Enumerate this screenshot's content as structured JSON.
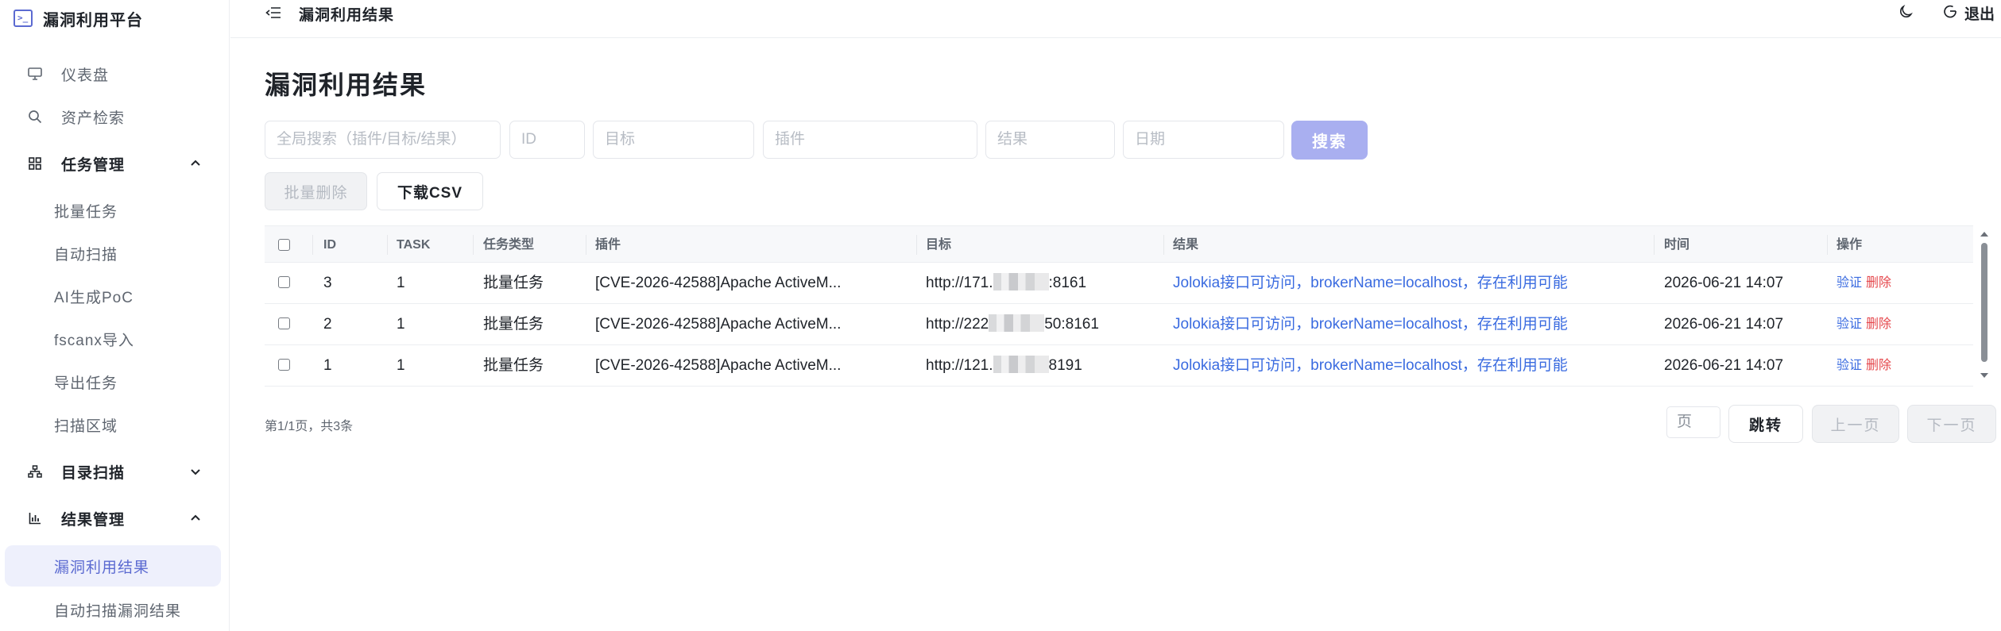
{
  "sidebar": {
    "brand_title": "漏洞利用平台",
    "items": [
      {
        "label": "仪表盘",
        "icon": "monitor-icon"
      },
      {
        "label": "资产检索",
        "icon": "search-icon"
      },
      {
        "label": "任务管理",
        "icon": "grid-icon",
        "expanded": true
      },
      {
        "label": "批量任务"
      },
      {
        "label": "自动扫描"
      },
      {
        "label": "AI生成PoC"
      },
      {
        "label": "fscanx导入"
      },
      {
        "label": "导出任务"
      },
      {
        "label": "扫描区域"
      },
      {
        "label": "目录扫描",
        "icon": "sitemap-icon",
        "expanded": false
      },
      {
        "label": "结果管理",
        "icon": "bar-chart-icon",
        "expanded": true
      },
      {
        "label": "漏洞利用结果",
        "active": true
      },
      {
        "label": "自动扫描漏洞结果"
      }
    ]
  },
  "header": {
    "title": "漏洞利用结果",
    "logout_label": "退出"
  },
  "main": {
    "title": "漏洞利用结果",
    "filters": {
      "global_placeholder": "全局搜索（插件/目标/结果）",
      "id_placeholder": "ID",
      "target_placeholder": "目标",
      "plugin_placeholder": "插件",
      "result_placeholder": "结果",
      "date_placeholder": "日期",
      "search_label": "搜索"
    },
    "actions": {
      "bulk_delete_label": "批量删除",
      "download_csv_label": "下载CSV"
    },
    "table": {
      "columns": [
        "ID",
        "TASK",
        "任务类型",
        "插件",
        "目标",
        "结果",
        "时间",
        "操作"
      ],
      "rows": [
        {
          "id": "3",
          "task": "1",
          "type": "批量任务",
          "plugin": "[CVE-2026-42588]Apache ActiveM...",
          "target_prefix": "http://171.",
          "target_suffix": ":8161",
          "result": "Jolokia接口可访问，brokerName=localhost，存在利用可能",
          "time": "2026-06-21 14:07",
          "verify": "验证",
          "delete": "删除"
        },
        {
          "id": "2",
          "task": "1",
          "type": "批量任务",
          "plugin": "[CVE-2026-42588]Apache ActiveM...",
          "target_prefix": "http://222",
          "target_suffix": "50:8161",
          "result": "Jolokia接口可访问，brokerName=localhost，存在利用可能",
          "time": "2026-06-21 14:07",
          "verify": "验证",
          "delete": "删除"
        },
        {
          "id": "1",
          "task": "1",
          "type": "批量任务",
          "plugin": "[CVE-2026-42588]Apache ActiveM...",
          "target_prefix": "http://121.",
          "target_suffix": "8191",
          "result": "Jolokia接口可访问，brokerName=localhost，存在利用可能",
          "time": "2026-06-21 14:07",
          "verify": "验证",
          "delete": "删除"
        }
      ]
    },
    "pagination": {
      "info": "第1/1页，共3条",
      "page_placeholder": "页",
      "go_label": "跳转",
      "prev_label": "上一页",
      "next_label": "下一页"
    }
  },
  "colors": {
    "accent": "#5b6ad1",
    "search_button": "#a9aff0",
    "link": "#3a6be0",
    "danger": "#e5484d",
    "active_bg": "#eef0fc"
  }
}
